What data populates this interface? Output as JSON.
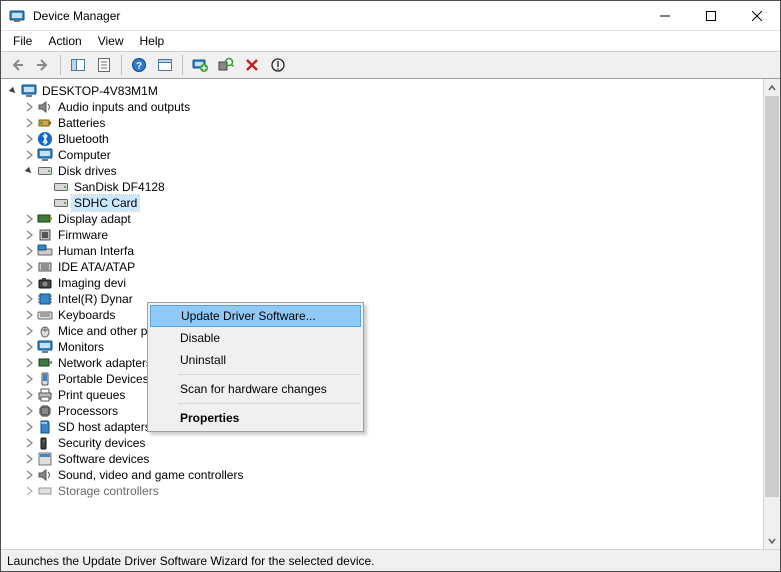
{
  "window": {
    "title": "Device Manager"
  },
  "menu": {
    "file": "File",
    "action": "Action",
    "view": "View",
    "help": "Help"
  },
  "tree": {
    "root": "DESKTOP-4V83M1M",
    "cats": {
      "audio": "Audio inputs and outputs",
      "batteries": "Batteries",
      "bluetooth": "Bluetooth",
      "computer": "Computer",
      "diskdrives": "Disk drives",
      "sandisk": "SanDisk DF4128",
      "sdhc": "SDHC Card",
      "display": "Display adapt",
      "firmware": "Firmware",
      "hid": "Human Interfa",
      "ide": "IDE ATA/ATAP",
      "imaging": "Imaging devi",
      "intel": "Intel(R) Dynar",
      "keyboards": "Keyboards",
      "mice": "Mice and other pointing devices",
      "monitors": "Monitors",
      "netadapters": "Network adapters",
      "portable": "Portable Devices",
      "printqueues": "Print queues",
      "processors": "Processors",
      "sdhost": "SD host adapters",
      "security": "Security devices",
      "software": "Software devices",
      "sound": "Sound, video and game controllers",
      "storage": "Storage controllers"
    }
  },
  "context_menu": {
    "update": "Update Driver Software...",
    "disable": "Disable",
    "uninstall": "Uninstall",
    "scan": "Scan for hardware changes",
    "properties": "Properties"
  },
  "status": {
    "text": "Launches the Update Driver Software Wizard for the selected device."
  }
}
